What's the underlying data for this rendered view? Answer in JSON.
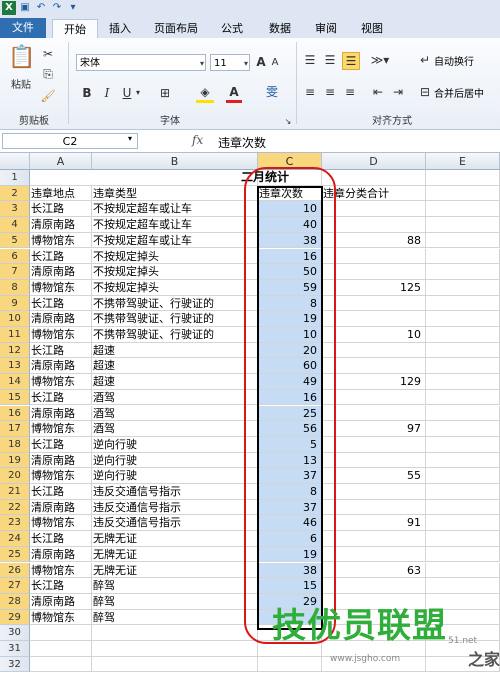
{
  "quick_access": [
    "excel-logo-icon",
    "save-icon",
    "undo-icon",
    "redo-icon",
    "dropdown-icon"
  ],
  "app_title": "",
  "tabs": [
    {
      "label": "文件",
      "active": false,
      "file": true
    },
    {
      "label": "开始",
      "active": true
    },
    {
      "label": "插入",
      "active": false
    },
    {
      "label": "页面布局",
      "active": false
    },
    {
      "label": "公式",
      "active": false
    },
    {
      "label": "数据",
      "active": false
    },
    {
      "label": "审阅",
      "active": false
    },
    {
      "label": "视图",
      "active": false
    }
  ],
  "ribbon": {
    "paste_label": "粘贴",
    "clipboard_group": "剪贴板",
    "font_name": "宋体",
    "font_size": "11",
    "font_group": "字体",
    "bold": "B",
    "italic": "I",
    "underline": "U",
    "grow_font": "A",
    "shrink_font": "A",
    "wen": "雯",
    "wrap_text": "自动换行",
    "merge_center": "合并后居中",
    "align_group": "对齐方式"
  },
  "formula_bar": {
    "name_box": "C2",
    "fx": "fx",
    "value": "违章次数"
  },
  "columns": [
    "A",
    "B",
    "C",
    "D",
    "E"
  ],
  "title_row": "二月统计",
  "headers": [
    "违章地点",
    "违章类型",
    "违章次数",
    "违章分类合计"
  ],
  "rows": [
    [
      "长江路",
      "不按规定超车或让车",
      "10",
      ""
    ],
    [
      "清原南路",
      "不按规定超车或让车",
      "40",
      ""
    ],
    [
      "博物馆东",
      "不按规定超车或让车",
      "38",
      "88"
    ],
    [
      "长江路",
      "不按规定掉头",
      "16",
      ""
    ],
    [
      "清原南路",
      "不按规定掉头",
      "50",
      ""
    ],
    [
      "博物馆东",
      "不按规定掉头",
      "59",
      "125"
    ],
    [
      "长江路",
      "不携带驾驶证、行驶证的",
      "8",
      ""
    ],
    [
      "清原南路",
      "不携带驾驶证、行驶证的",
      "19",
      ""
    ],
    [
      "博物馆东",
      "不携带驾驶证、行驶证的",
      "10",
      "10"
    ],
    [
      "长江路",
      "超速",
      "20",
      ""
    ],
    [
      "清原南路",
      "超速",
      "60",
      ""
    ],
    [
      "博物馆东",
      "超速",
      "49",
      "129"
    ],
    [
      "长江路",
      "酒驾",
      "16",
      ""
    ],
    [
      "清原南路",
      "酒驾",
      "25",
      ""
    ],
    [
      "博物馆东",
      "酒驾",
      "56",
      "97"
    ],
    [
      "长江路",
      "逆向行驶",
      "5",
      ""
    ],
    [
      "清原南路",
      "逆向行驶",
      "13",
      ""
    ],
    [
      "博物馆东",
      "逆向行驶",
      "37",
      "55"
    ],
    [
      "长江路",
      "违反交通信号指示",
      "8",
      ""
    ],
    [
      "清原南路",
      "违反交通信号指示",
      "37",
      ""
    ],
    [
      "博物馆东",
      "违反交通信号指示",
      "46",
      "91"
    ],
    [
      "长江路",
      "无牌无证",
      "6",
      ""
    ],
    [
      "清原南路",
      "无牌无证",
      "19",
      ""
    ],
    [
      "博物馆东",
      "无牌无证",
      "38",
      "63"
    ],
    [
      "长江路",
      "醉驾",
      "15",
      ""
    ],
    [
      "清原南路",
      "醉驾",
      "29",
      ""
    ],
    [
      "博物馆东",
      "醉驾",
      "",
      ""
    ],
    [
      "",
      "",
      "",
      ""
    ],
    [
      "",
      "",
      "",
      ""
    ],
    [
      "",
      "",
      "",
      ""
    ]
  ],
  "row_numbers": [
    "1",
    "2",
    "3",
    "4",
    "5",
    "6",
    "7",
    "8",
    "9",
    "10",
    "11",
    "12",
    "13",
    "14",
    "15",
    "16",
    "17",
    "18",
    "19",
    "20",
    "21",
    "22",
    "23",
    "24",
    "25",
    "26",
    "27",
    "28",
    "29",
    "30",
    "31",
    "32"
  ],
  "watermark": {
    "main": "技优员联盟",
    "url": "www.jsgho.com",
    "logo": "之家",
    "prefix": "51.net"
  },
  "colors": {
    "accent": "#2f6fb1",
    "selection": "#c5dcf4",
    "header_sel": "#f9d77e",
    "annotation": "#d81818",
    "watermark": "#2fae3a"
  }
}
